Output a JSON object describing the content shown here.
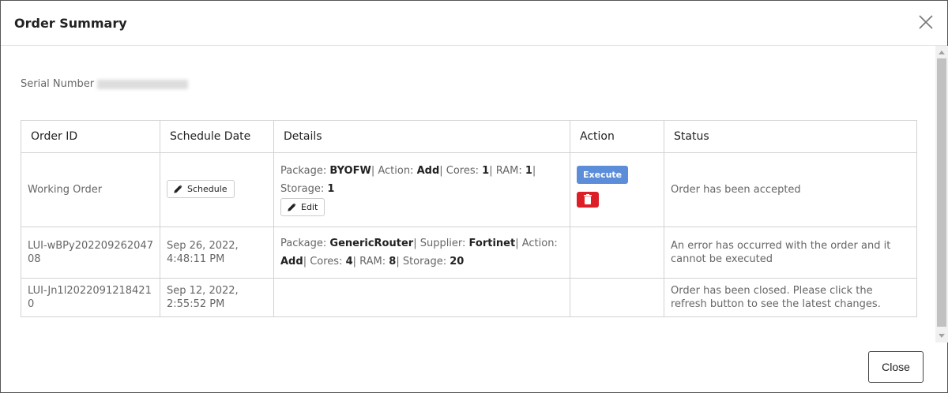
{
  "dialog": {
    "title": "Order Summary",
    "close_label": "Close"
  },
  "serial": {
    "label": "Serial Number"
  },
  "table": {
    "headers": [
      "Order ID",
      "Schedule Date",
      "Details",
      "Action",
      "Status"
    ],
    "rows": [
      {
        "order_id": "Working Order",
        "schedule_button": "Schedule",
        "details": [
          {
            "k": "Package: ",
            "v": "BYOFW"
          },
          {
            "k": "| Action: ",
            "v": "Add"
          },
          {
            "k": "| Cores: ",
            "v": "1"
          },
          {
            "k": "| RAM: ",
            "v": "1"
          },
          {
            "k": "| Storage: ",
            "v": "1"
          }
        ],
        "edit_button": "Edit",
        "execute_button": "Execute",
        "status": "Order has been accepted"
      },
      {
        "order_id": "LUI-wBPy20220926204708",
        "schedule_date": "Sep 26, 2022, 4:48:11 PM",
        "details": [
          {
            "k": "Package: ",
            "v": "GenericRouter"
          },
          {
            "k": "| Supplier: ",
            "v": "Fortinet"
          },
          {
            "k": "| Action: ",
            "v": "Add"
          },
          {
            "k": "| Cores: ",
            "v": "4"
          },
          {
            "k": "| RAM: ",
            "v": "8"
          },
          {
            "k": "| Storage: ",
            "v": "20"
          }
        ],
        "status": "An error has occurred with the order and it cannot be executed"
      },
      {
        "order_id": "LUI-Jn1l20220912184210",
        "schedule_date": "Sep 12, 2022, 2:55:52 PM",
        "status": "Order has been closed. Please click the refresh button to see the latest changes."
      }
    ]
  },
  "colors": {
    "execute": "#5b8dd9",
    "delete": "#dc1f26"
  }
}
